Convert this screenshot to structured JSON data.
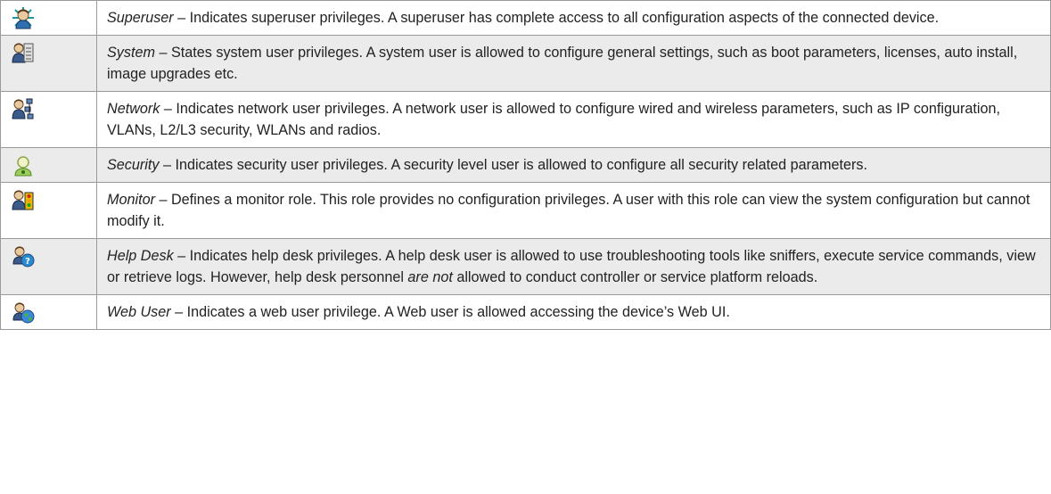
{
  "rows": [
    {
      "role": "Superuser",
      "description": " – Indicates superuser privileges. A superuser has complete access to all configuration aspects of the connected device.",
      "icon": "superuser-icon"
    },
    {
      "role": "System",
      "description": " – States system user privileges. A system user is allowed to configure general settings, such as boot parameters, licenses, auto install, image upgrades etc.",
      "icon": "system-user-icon"
    },
    {
      "role": "Network",
      "description": " – Indicates network user privileges. A network user is allowed to configure wired and wireless parameters, such as IP configuration, VLANs, L2/L3 security, WLANs and radios.",
      "icon": "network-user-icon"
    },
    {
      "role": "Security",
      "description": " – Indicates security user privileges. A security level user is allowed to configure all security related parameters.",
      "icon": "security-user-icon"
    },
    {
      "role": "Monitor",
      "description": " – Defines a monitor role. This role provides no configuration privileges. A user with this role can view the system configuration but cannot modify it.",
      "icon": "monitor-user-icon"
    },
    {
      "role": "Help Desk",
      "description_before": " – Indicates help desk privileges. A help desk user is allowed to use troubleshooting tools like sniffers, execute service commands, view or retrieve logs. However, help desk personnel ",
      "description_em": "are not",
      "description_after": " allowed to conduct controller or service platform reloads.",
      "icon": "help-desk-user-icon"
    },
    {
      "role": "Web User",
      "description": " – Indicates a web user privilege. A Web user is allowed accessing the device’s Web UI.",
      "icon": "web-user-icon"
    }
  ]
}
